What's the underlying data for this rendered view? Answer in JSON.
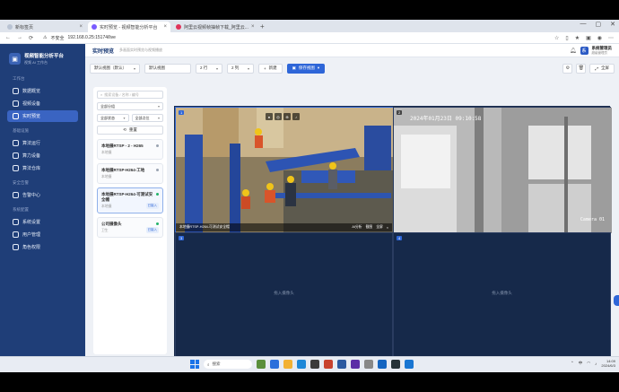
{
  "browser": {
    "tabs": [
      {
        "label": "新标签页",
        "color": "#b9c3d3",
        "active": false
      },
      {
        "label": "实时预览 - 视频智能分析平台",
        "color": "#7a5cff",
        "active": true
      },
      {
        "label": "阿里云视频帧抽帧下载_阿里云...",
        "color": "#e0335a",
        "active": false
      }
    ],
    "new_tab": "+",
    "url_prefix": "不安全",
    "url": "192.168.0.25:15174/live",
    "window_controls": [
      "—",
      "▢",
      "✕"
    ]
  },
  "app": {
    "logo_title": "视频智能分析平台",
    "logo_sub": "视频 AI 工作台",
    "nav_groups": [
      {
        "title": "工作台",
        "items": [
          {
            "label": "数据概览",
            "active": false
          },
          {
            "label": "视频设备",
            "active": false
          },
          {
            "label": "实时预览",
            "active": true
          }
        ]
      },
      {
        "title": "基础设施",
        "items": [
          {
            "label": "算法运行",
            "active": false
          },
          {
            "label": "算力设备",
            "active": false
          },
          {
            "label": "算法仓库",
            "active": false
          }
        ]
      },
      {
        "title": "安全告警",
        "items": [
          {
            "label": "告警中心",
            "active": false
          }
        ]
      },
      {
        "title": "系统配置",
        "items": [
          {
            "label": "系统设置",
            "active": false
          },
          {
            "label": "用户管理",
            "active": false
          },
          {
            "label": "角色权限",
            "active": false
          }
        ]
      }
    ],
    "page_title": "实时预览",
    "page_sub": "多画面实时预览与视频播放",
    "user_name": "系统管理员",
    "user_role": "超级管理员",
    "avatar_letter": "系"
  },
  "toolbar": {
    "view_select": "默认视图（默认）",
    "view_name": "默认视图",
    "rows": "2 行",
    "cols": "2 列",
    "new_label": "新建",
    "save_label": "保存视图",
    "fullscreen_label": "全屏"
  },
  "panel": {
    "search_placeholder": "搜索设备 / 名称 / 编号",
    "group_filter": "全部分组",
    "status_filter": "全部状态",
    "point_filter": "全部点位",
    "reset_label": "重置",
    "cameras": [
      {
        "name": "本地摄RTSP - 2 - H265",
        "location": "本地摄",
        "status": "#9aa3b1",
        "tag": "",
        "selected": false
      },
      {
        "name": "本地摄RTSP-H264-工地",
        "location": "本地摄",
        "status": "#9aa3b1",
        "tag": "",
        "selected": false
      },
      {
        "name": "本地摄RTSP-H264-可测试安全帽",
        "location": "本地摄",
        "status": "#24b36b",
        "tag": "已接入",
        "selected": true
      },
      {
        "name": "公司摄像头",
        "location": "卫生",
        "status": "#24b36b",
        "tag": "已接入",
        "selected": false
      }
    ]
  },
  "grid": {
    "cells": [
      {
        "num": "1",
        "caption": "本地摄RTSP-H264-可测试安全帽",
        "actions": [
          "AI分析",
          "截图",
          "全屏"
        ]
      },
      {
        "num": "2",
        "timestamp": "2024年01月23日 09:10:58",
        "camera": "Camera 01"
      },
      {
        "num": "3",
        "empty": "拖入摄像头"
      },
      {
        "num": "4",
        "empty": "拖入摄像头"
      }
    ]
  },
  "taskbar": {
    "search": "搜索",
    "tray_ime": "中",
    "time": "14:09",
    "date": "2024/6/3"
  }
}
